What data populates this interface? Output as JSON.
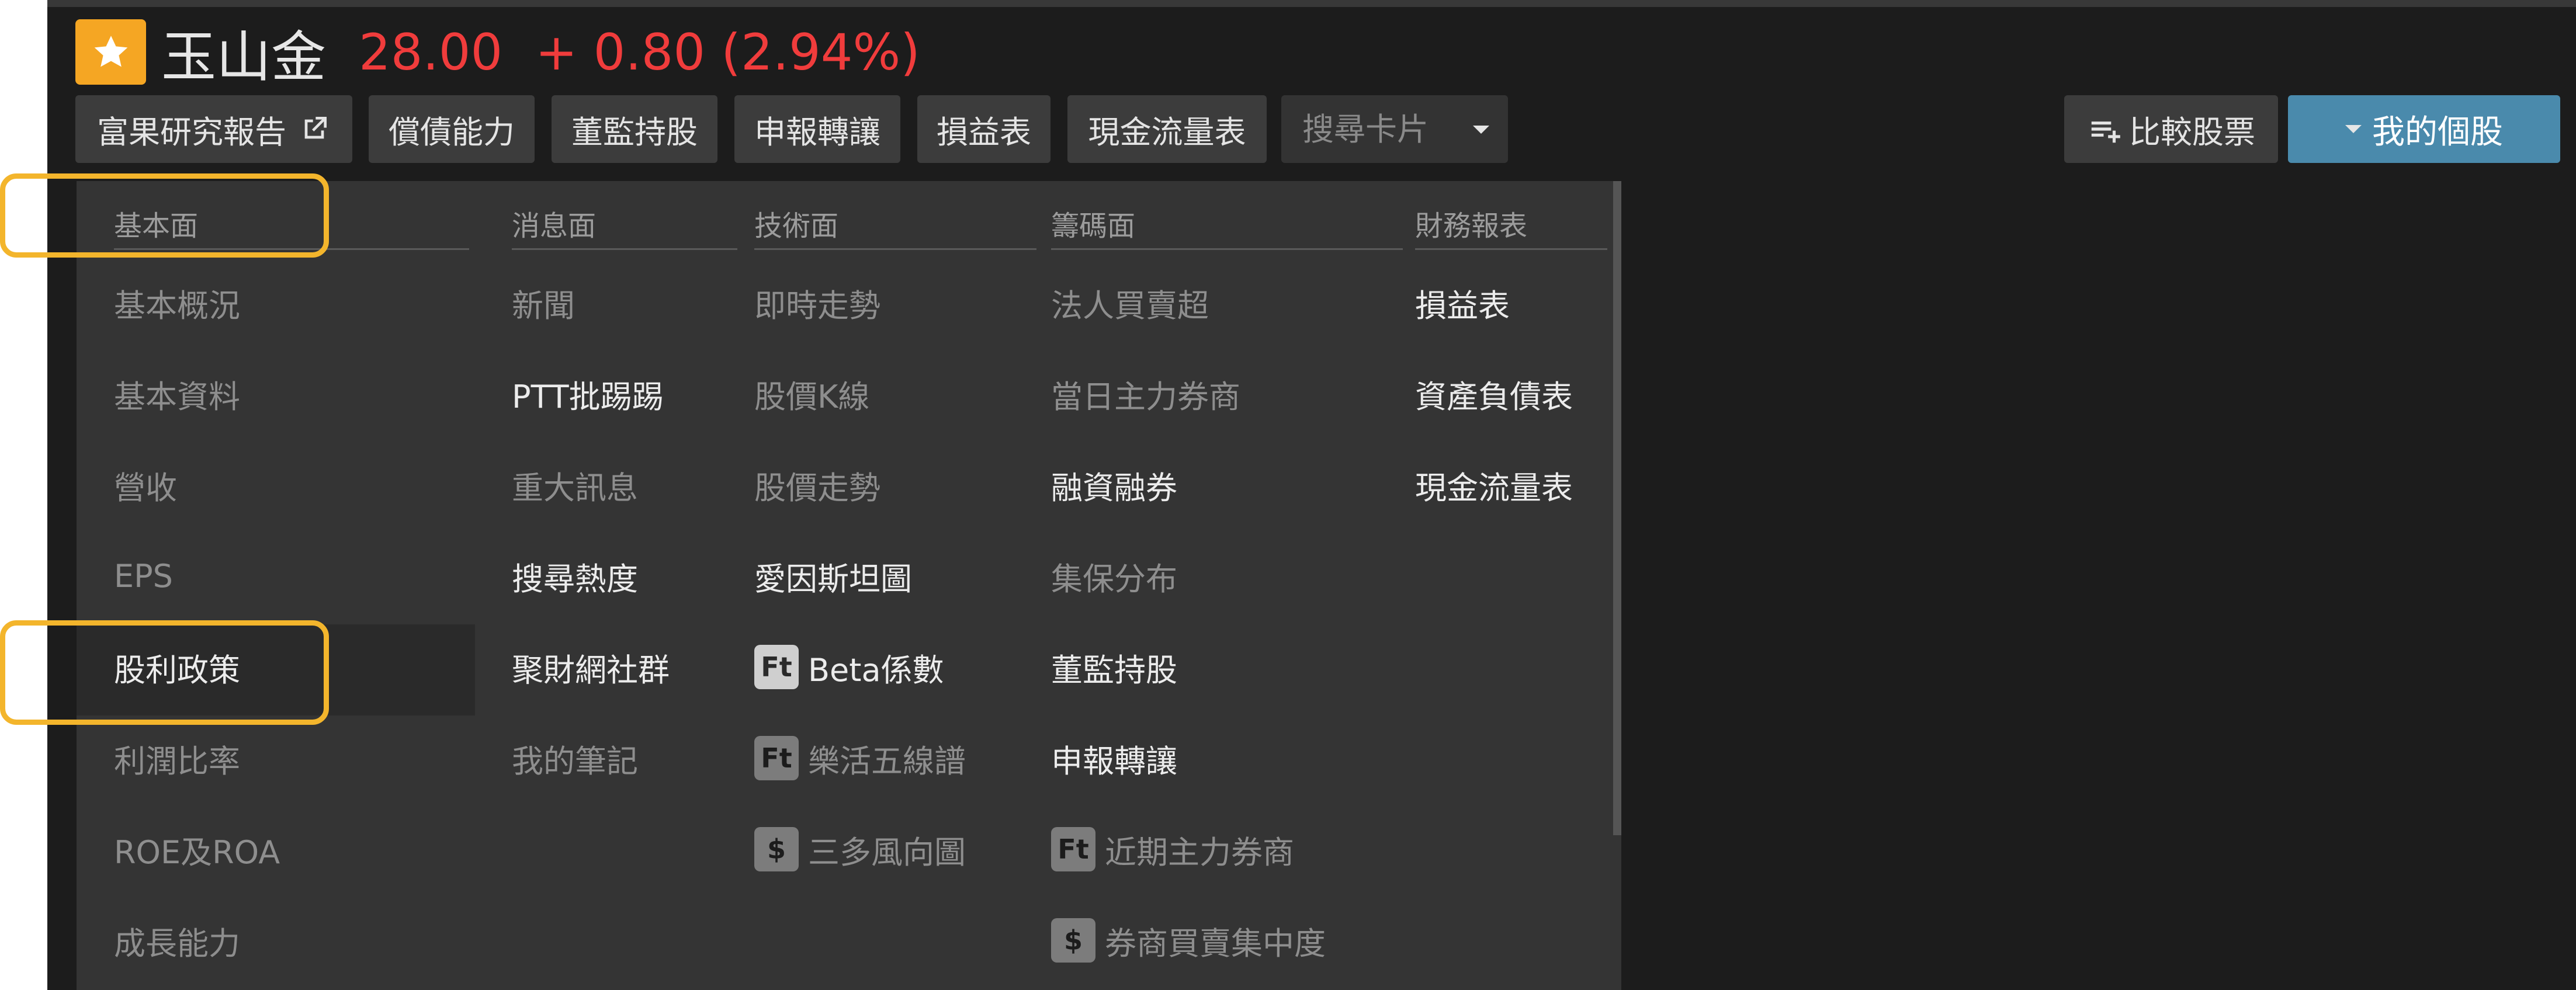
{
  "header": {
    "stock_name": "玉山金",
    "price": "28.00",
    "change": "+ 0.80 (2.94%)"
  },
  "toolbar": {
    "research_report": "富果研究報告",
    "solvency": "償債能力",
    "director_holdings": "董監持股",
    "declared_transfer": "申報轉讓",
    "income_statement": "損益表",
    "cash_flow": "現金流量表",
    "search_placeholder": "搜尋卡片",
    "compare_stocks": "比較股票",
    "my_stocks": "我的個股"
  },
  "menu": {
    "fundamentals": {
      "header": "基本面",
      "items": [
        "基本概況",
        "基本資料",
        "營收",
        "EPS",
        "股利政策",
        "利潤比率",
        "ROE及ROA",
        "成長能力"
      ]
    },
    "news": {
      "header": "消息面",
      "items": [
        "新聞",
        "PTT批踢踢",
        "重大訊息",
        "搜尋熱度",
        "聚財網社群",
        "我的筆記"
      ]
    },
    "technical": {
      "header": "技術面",
      "items": [
        "即時走勢",
        "股價K線",
        "股價走勢",
        "愛因斯坦圖",
        "Beta係數",
        "樂活五線譜",
        "三多風向圖"
      ]
    },
    "chips": {
      "header": "籌碼面",
      "items": [
        "法人買賣超",
        "當日主力券商",
        "融資融券",
        "集保分布",
        "董監持股",
        "申報轉讓",
        "近期主力券商",
        "券商買賣集中度"
      ]
    },
    "financial": {
      "header": "財務報表",
      "items": [
        "損益表",
        "資產負債表",
        "現金流量表"
      ]
    }
  },
  "badges": {
    "ft": "Ft",
    "dollar": "$"
  },
  "colors": {
    "background": "#1c1c1c",
    "panel": "#343434",
    "price_up": "#f03c3c",
    "accent_button": "#4a8aac",
    "highlight": "#f3b52c",
    "star": "#f5a623"
  },
  "icons": [
    "star-icon",
    "external-link-icon",
    "chevron-down-icon",
    "playlist-add-icon",
    "caret-down-icon"
  ]
}
